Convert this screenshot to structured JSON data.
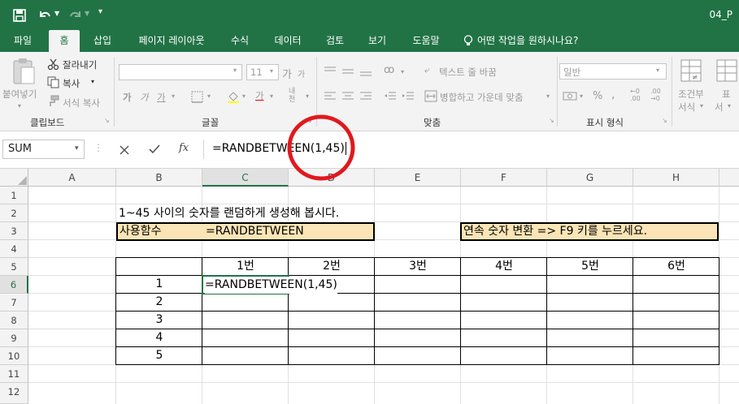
{
  "titlebar": {
    "title": "04_P",
    "qat": [
      "save-icon",
      "undo-icon",
      "redo-icon",
      "customize-icon"
    ]
  },
  "tabs": [
    "파일",
    "홈",
    "삽입",
    "페이지 레이아웃",
    "수식",
    "데이터",
    "검토",
    "보기",
    "도움말"
  ],
  "tell_me": "어떤 작업을 원하시나요?",
  "ribbon": {
    "clipboard": {
      "paste": "붙여넣기",
      "cut": "잘라내기",
      "copy": "복사",
      "format_painter": "서식 복사",
      "group": "클립보드"
    },
    "font": {
      "size": "11",
      "bold": "가",
      "italic": "가",
      "underline": "가",
      "group": "글꼴",
      "grow": "가",
      "shrink": "가",
      "phonetic": "내천",
      "font_color": "가"
    },
    "alignment": {
      "wrap": "텍스트 줄 바꿈",
      "merge": "병합하고 가운데 맞춤",
      "group": "맞춤"
    },
    "number": {
      "format": "일반",
      "percent": "%",
      "group": "표시 형식"
    },
    "styles": {
      "conditional": "조건부",
      "conditional2": "서식",
      "group_partial": "표",
      "group_partial2": "서"
    }
  },
  "formula_bar": {
    "name_box": "SUM",
    "formula": "=RANDBETWEEN(1,45)",
    "fx": "fx"
  },
  "columns": [
    "A",
    "B",
    "C",
    "D",
    "E",
    "F",
    "G",
    "H"
  ],
  "rows": [
    "1",
    "2",
    "3",
    "4",
    "5",
    "6",
    "7",
    "8",
    "9",
    "10",
    "11",
    "12"
  ],
  "cells": {
    "b2": "1~45 사이의 숫자를 랜덤하게 생성해 봅시다.",
    "b3": "사용함수",
    "c3": "=RANDBETWEEN",
    "f3": "연속 숫자 변환 => F9 키를 누르세요.",
    "header_row": [
      "1번",
      "2번",
      "3번",
      "4번",
      "5번",
      "6번"
    ],
    "index": [
      "1",
      "2",
      "3",
      "4",
      "5"
    ],
    "c6": "=RANDBETWEEN(1,45)"
  },
  "colors": {
    "accent": "#217346",
    "highlight_box": "#fbe5b6",
    "annotation_circle": "#e0191e"
  }
}
